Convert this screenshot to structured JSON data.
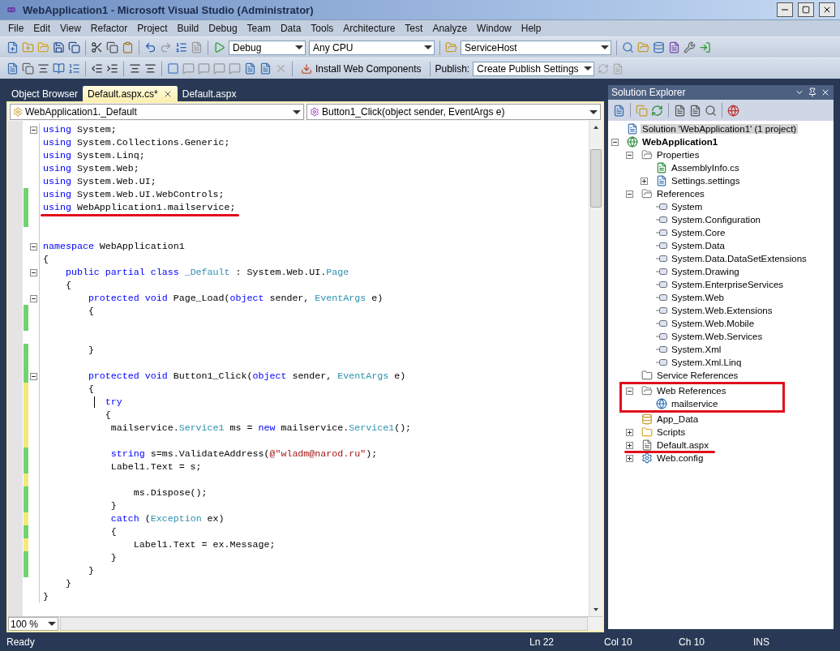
{
  "window": {
    "title": "WebApplication1 - Microsoft Visual Studio (Administrator)"
  },
  "menu": [
    "File",
    "Edit",
    "View",
    "Refactor",
    "Project",
    "Build",
    "Debug",
    "Team",
    "Data",
    "Tools",
    "Architecture",
    "Test",
    "Analyze",
    "Window",
    "Help"
  ],
  "toolbar": {
    "configuration": "Debug",
    "platform": "Any CPU",
    "startup": "ServiceHost",
    "install_button": "Install Web Components",
    "publish_label": "Publish:",
    "publish_profile": "Create Publish Settings"
  },
  "tabs": [
    {
      "label": "Object Browser",
      "selected": false
    },
    {
      "label": "Default.aspx.cs*",
      "selected": true
    },
    {
      "label": "Default.aspx",
      "selected": false
    }
  ],
  "editor": {
    "type_dropdown": "WebApplication1._Default",
    "member_dropdown": "Button1_Click(object sender, EventArgs e)",
    "zoom": "100 %",
    "lines": [
      {
        "changed": false,
        "fold": true,
        "tokens": [
          {
            "kind": "keyword",
            "text": "using"
          },
          {
            "kind": "plain",
            "text": " System;"
          }
        ]
      },
      {
        "changed": false,
        "tokens": [
          {
            "kind": "keyword",
            "text": "using"
          },
          {
            "kind": "plain",
            "text": " System.Collections.Generic;"
          }
        ]
      },
      {
        "changed": false,
        "tokens": [
          {
            "kind": "keyword",
            "text": "using"
          },
          {
            "kind": "plain",
            "text": " System.Linq;"
          }
        ]
      },
      {
        "changed": false,
        "tokens": [
          {
            "kind": "keyword",
            "text": "using"
          },
          {
            "kind": "plain",
            "text": " System.Web;"
          }
        ]
      },
      {
        "changed": false,
        "tokens": [
          {
            "kind": "keyword",
            "text": "using"
          },
          {
            "kind": "plain",
            "text": " System.Web.UI;"
          }
        ]
      },
      {
        "changed": true,
        "saved": true,
        "tokens": [
          {
            "kind": "keyword",
            "text": "using"
          },
          {
            "kind": "plain",
            "text": " System.Web.UI.WebControls;"
          }
        ]
      },
      {
        "changed": true,
        "saved": true,
        "underlined": true,
        "tokens": [
          {
            "kind": "keyword",
            "text": "using"
          },
          {
            "kind": "plain",
            "text": " WebApplication1.mailservice;"
          }
        ]
      },
      {
        "changed": true,
        "saved": true
      },
      {
        "changed": false
      },
      {
        "changed": false,
        "fold": true,
        "tokens": [
          {
            "kind": "keyword",
            "text": "namespace"
          },
          {
            "kind": "plain",
            "text": " WebApplication1"
          }
        ]
      },
      {
        "changed": false,
        "tokens": [
          {
            "kind": "plain",
            "text": "{"
          }
        ]
      },
      {
        "changed": false,
        "fold": true,
        "tokens": [
          {
            "kind": "keyword",
            "text": "    public partial class "
          },
          {
            "kind": "type",
            "text": "_Default"
          },
          {
            "kind": "plain",
            "text": " : System.Web.UI."
          },
          {
            "kind": "type",
            "text": "Page"
          }
        ]
      },
      {
        "changed": false,
        "tokens": [
          {
            "kind": "plain",
            "text": "    {"
          }
        ]
      },
      {
        "changed": false,
        "fold": true,
        "tokens": [
          {
            "kind": "keyword",
            "text": "        protected void"
          },
          {
            "kind": "plain",
            "text": " Page_Load("
          },
          {
            "kind": "keyword",
            "text": "object"
          },
          {
            "kind": "plain",
            "text": " sender, "
          },
          {
            "kind": "type",
            "text": "EventArgs"
          },
          {
            "kind": "plain",
            "text": " e)"
          }
        ]
      },
      {
        "changed": true,
        "saved": true,
        "tokens": [
          {
            "kind": "plain",
            "text": "        {"
          }
        ]
      },
      {
        "changed": true,
        "saved": true
      },
      {
        "changed": false
      },
      {
        "changed": true,
        "saved": true,
        "tokens": [
          {
            "kind": "plain",
            "text": "        }"
          }
        ]
      },
      {
        "changed": true,
        "saved": true
      },
      {
        "changed": true,
        "saved": true,
        "fold": true,
        "tokens": [
          {
            "kind": "keyword",
            "text": "        protected void"
          },
          {
            "kind": "plain",
            "text": " Button1_Click("
          },
          {
            "kind": "keyword",
            "text": "object"
          },
          {
            "kind": "plain",
            "text": " sender, "
          },
          {
            "kind": "type",
            "text": "EventArgs"
          },
          {
            "kind": "plain",
            "text": " e)"
          }
        ]
      },
      {
        "changed": true,
        "saved": false,
        "tokens": [
          {
            "kind": "plain",
            "text": "        {"
          }
        ]
      },
      {
        "changed": true,
        "saved": false,
        "caret": true,
        "tokens": [
          {
            "kind": "keyword",
            "text": "           try"
          }
        ]
      },
      {
        "changed": true,
        "saved": false,
        "tokens": [
          {
            "kind": "plain",
            "text": "           {"
          }
        ]
      },
      {
        "changed": true,
        "saved": false,
        "tokens": [
          {
            "kind": "plain",
            "text": "            mailservice."
          },
          {
            "kind": "type",
            "text": "Service1"
          },
          {
            "kind": "plain",
            "text": " ms = "
          },
          {
            "kind": "keyword",
            "text": "new"
          },
          {
            "kind": "plain",
            "text": " mailservice."
          },
          {
            "kind": "type",
            "text": "Service1"
          },
          {
            "kind": "plain",
            "text": "();"
          }
        ]
      },
      {
        "changed": true,
        "saved": false
      },
      {
        "changed": true,
        "saved": true,
        "tokens": [
          {
            "kind": "keyword",
            "text": "            string"
          },
          {
            "kind": "plain",
            "text": " s=ms.ValidateAddress("
          },
          {
            "kind": "string",
            "text": "@\"wladm@narod.ru\""
          },
          {
            "kind": "plain",
            "text": ");"
          }
        ]
      },
      {
        "changed": true,
        "saved": true,
        "tokens": [
          {
            "kind": "plain",
            "text": "            Label1.Text = s;"
          }
        ]
      },
      {
        "changed": true,
        "saved": false
      },
      {
        "changed": true,
        "saved": true,
        "tokens": [
          {
            "kind": "plain",
            "text": "                ms.Dispose();"
          }
        ]
      },
      {
        "changed": true,
        "saved": true,
        "tokens": [
          {
            "kind": "plain",
            "text": "            }"
          }
        ]
      },
      {
        "changed": true,
        "saved": false,
        "tokens": [
          {
            "kind": "keyword",
            "text": "            catch"
          },
          {
            "kind": "plain",
            "text": " ("
          },
          {
            "kind": "type",
            "text": "Exception"
          },
          {
            "kind": "plain",
            "text": " ex)"
          }
        ]
      },
      {
        "changed": true,
        "saved": true,
        "tokens": [
          {
            "kind": "plain",
            "text": "            {"
          }
        ]
      },
      {
        "changed": true,
        "saved": false,
        "tokens": [
          {
            "kind": "plain",
            "text": "                Label1.Text = ex.Message;"
          }
        ]
      },
      {
        "changed": true,
        "saved": true,
        "tokens": [
          {
            "kind": "plain",
            "text": "            }"
          }
        ]
      },
      {
        "changed": true,
        "saved": true,
        "tokens": [
          {
            "kind": "plain",
            "text": "        }"
          }
        ]
      },
      {
        "changed": false,
        "tokens": [
          {
            "kind": "plain",
            "text": "    }"
          }
        ]
      },
      {
        "changed": false,
        "tokens": [
          {
            "kind": "plain",
            "text": "}"
          }
        ]
      }
    ]
  },
  "solution_explorer": {
    "title": "Solution Explorer",
    "tree": [
      {
        "label": "Solution 'WebApplication1' (1 project)",
        "kind": "solution",
        "selected": true
      },
      {
        "label": "WebApplication1",
        "kind": "project",
        "selected": false,
        "expanded": true,
        "children": [
          {
            "label": "Properties",
            "kind": "folder",
            "selected": false,
            "expanded": true,
            "children": [
              {
                "label": "AssemblyInfo.cs",
                "kind": "csfile",
                "selected": false
              },
              {
                "label": "Settings.settings",
                "kind": "settings",
                "selected": false,
                "expanded": false
              }
            ]
          },
          {
            "label": "References",
            "kind": "folder",
            "selected": false,
            "expanded": true,
            "children": [
              {
                "label": "System",
                "kind": "reference",
                "selected": false
              },
              {
                "label": "System.Configuration",
                "kind": "reference",
                "selected": false
              },
              {
                "label": "System.Core",
                "kind": "reference",
                "selected": false
              },
              {
                "label": "System.Data",
                "kind": "reference",
                "selected": false
              },
              {
                "label": "System.Data.DataSetExtensions",
                "kind": "reference",
                "selected": false
              },
              {
                "label": "System.Drawing",
                "kind": "reference",
                "selected": false
              },
              {
                "label": "System.EnterpriseServices",
                "kind": "reference",
                "selected": false
              },
              {
                "label": "System.Web",
                "kind": "reference",
                "selected": false
              },
              {
                "label": "System.Web.Extensions",
                "kind": "reference",
                "selected": false
              },
              {
                "label": "System.Web.Mobile",
                "kind": "reference",
                "selected": false
              },
              {
                "label": "System.Web.Services",
                "kind": "reference",
                "selected": false
              },
              {
                "label": "System.Xml",
                "kind": "reference",
                "selected": false
              },
              {
                "label": "System.Xml.Linq",
                "kind": "reference",
                "selected": false
              }
            ]
          },
          {
            "label": "Service References",
            "kind": "servicefolder",
            "selected": false
          },
          {
            "label": "Web References",
            "kind": "folder",
            "selected": false,
            "expanded": true,
            "boxed": true,
            "children": [
              {
                "label": "mailservice",
                "kind": "webservice",
                "selected": false
              }
            ]
          },
          {
            "label": "App_Data",
            "kind": "datafolder",
            "selected": false
          },
          {
            "label": "Scripts",
            "kind": "closedfolder",
            "selected": false,
            "expanded": false
          },
          {
            "label": "Default.aspx",
            "kind": "page",
            "selected": false,
            "expanded": false,
            "underlined": true
          },
          {
            "label": "Web.config",
            "kind": "config",
            "selected": false,
            "expanded": false
          }
        ]
      }
    ]
  },
  "status_bar": {
    "message": "Ready",
    "line": "Ln 22",
    "column": "Col 10",
    "char": "Ch 10",
    "mode": "INS"
  }
}
